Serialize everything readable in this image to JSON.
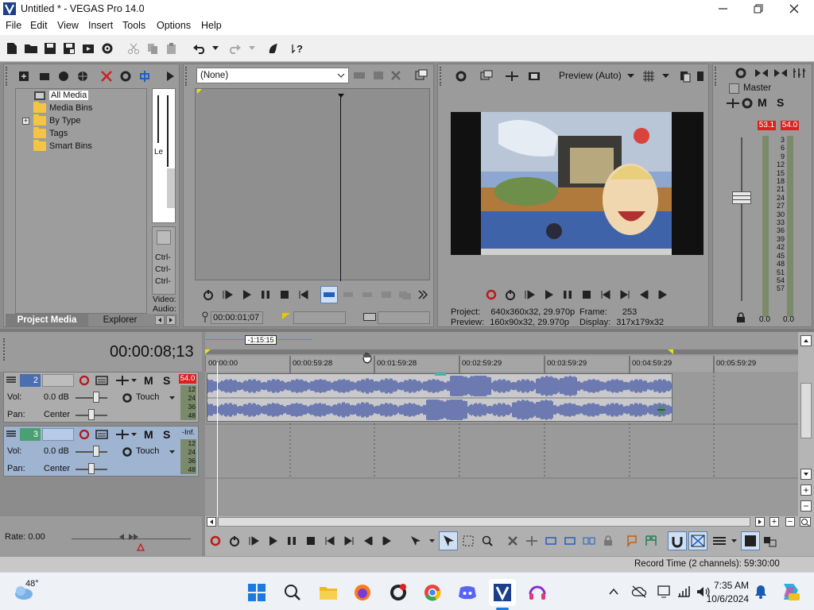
{
  "window": {
    "title": "Untitled * - VEGAS Pro 14.0"
  },
  "menu": [
    "File",
    "Edit",
    "View",
    "Insert",
    "Tools",
    "Options",
    "Help"
  ],
  "project_media": {
    "tree": [
      "All Media",
      "Media Bins",
      "By Type",
      "Tags",
      "Smart Bins"
    ],
    "tabs": [
      "Project Media",
      "Explorer"
    ],
    "side_items": [
      "Le",
      "Ctrl-",
      "Ctrl-",
      "Ctrl-",
      "Video:",
      "Audio:"
    ]
  },
  "trimmer": {
    "dropdown_value": "(None)",
    "timecode": "00:00:01;07"
  },
  "preview": {
    "mode_label": "Preview (Auto)",
    "project_label": "Project:",
    "project_value": "640x360x32, 29.970p",
    "preview_label": "Preview:",
    "preview_value": "160x90x32, 29.970p",
    "frame_label": "Frame:",
    "frame_value": "253",
    "display_label": "Display:",
    "display_value": "317x179x32"
  },
  "master": {
    "title": "Master",
    "peak_left": "53.1",
    "peak_right": "54.0",
    "scale": [
      "3",
      "6",
      "9",
      "12",
      "15",
      "18",
      "21",
      "24",
      "27",
      "30",
      "33",
      "36",
      "39",
      "42",
      "45",
      "48",
      "51",
      "54",
      "57"
    ],
    "bottom_left": "0.0",
    "bottom_right": "0.0",
    "m_label": "M",
    "s_label": "S"
  },
  "timeline": {
    "current_time": "00:00:08;13",
    "loop_label": "-1:15:15",
    "ruler_labels": [
      "00:00:00",
      "00:00:59:28",
      "00:01:59:28",
      "00:02:59:29",
      "00:03:59:29",
      "00:04:59:29",
      "00:05:59:29"
    ],
    "tracks": [
      {
        "number": "2",
        "vol_label": "Vol:",
        "vol_value": "0.0 dB",
        "pan_label": "Pan:",
        "pan_value": "Center",
        "mode": "Touch",
        "meter_peak": "54.0",
        "meter_scale": [
          "12",
          "24",
          "36",
          "48"
        ]
      },
      {
        "number": "3",
        "vol_label": "Vol:",
        "vol_value": "0.0 dB",
        "pan_label": "Pan:",
        "pan_value": "Center",
        "mode": "Touch",
        "meter_peak": "-Inf.",
        "meter_scale": [
          "12",
          "24",
          "36",
          "48"
        ]
      }
    ],
    "rate_label": "Rate: 0.00",
    "m_label": "M",
    "s_label": "S"
  },
  "status_bar": {
    "record_time": "Record Time (2 channels): 59:30:00"
  },
  "taskbar": {
    "weather": "48°",
    "time": "7:35 AM",
    "date": "10/6/2024"
  },
  "colors": {
    "accent": "#0078d4",
    "waveform": "#5566aa",
    "clip_bg": "#c9c9cc",
    "meter_red": "#e02020",
    "selected_track": "#9fb4d0"
  }
}
